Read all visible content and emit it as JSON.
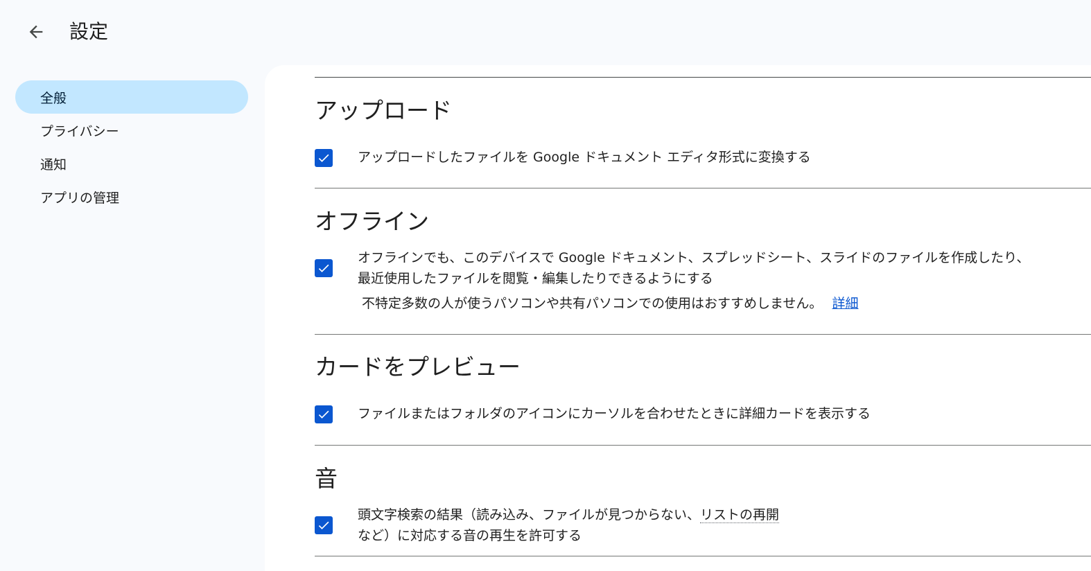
{
  "header": {
    "title": "設定"
  },
  "sidebar": {
    "items": [
      {
        "label": "全般"
      },
      {
        "label": "プライバシー"
      },
      {
        "label": "通知"
      },
      {
        "label": "アプリの管理"
      }
    ]
  },
  "sections": {
    "upload": {
      "title": "アップロード",
      "option": "アップロードしたファイルを Google ドキュメント エディタ形式に変換する"
    },
    "offline": {
      "title": "オフライン",
      "option_line1": "オフラインでも、このデバイスで Google ドキュメント、スプレッドシート、スライドのファイルを作成したり、",
      "option_line2": "最近使用したファイルを閲覧・編集したりできるようにする",
      "note": "不特定多数の人が使うパソコンや共有パソコンでの使用はおすすめしません。",
      "link": "詳細"
    },
    "preview": {
      "title": "カードをプレビュー",
      "option": "ファイルまたはフォルダのアイコンにカーソルを合わせたときに詳細カードを表示する"
    },
    "sound": {
      "title": "音",
      "option_line1_a": "頭文字検索の結果（読み込み、ファイルが見つからない、",
      "option_line1_b": "リストの再開",
      "option_line2": "など）に対応する音の再生を許可する"
    }
  },
  "colors": {
    "accent": "#0b57d0",
    "nav_active_bg": "#c2e7ff",
    "page_bg": "#f8fafd"
  },
  "icons": {
    "back": "arrow-back-icon",
    "check": "check-icon"
  }
}
